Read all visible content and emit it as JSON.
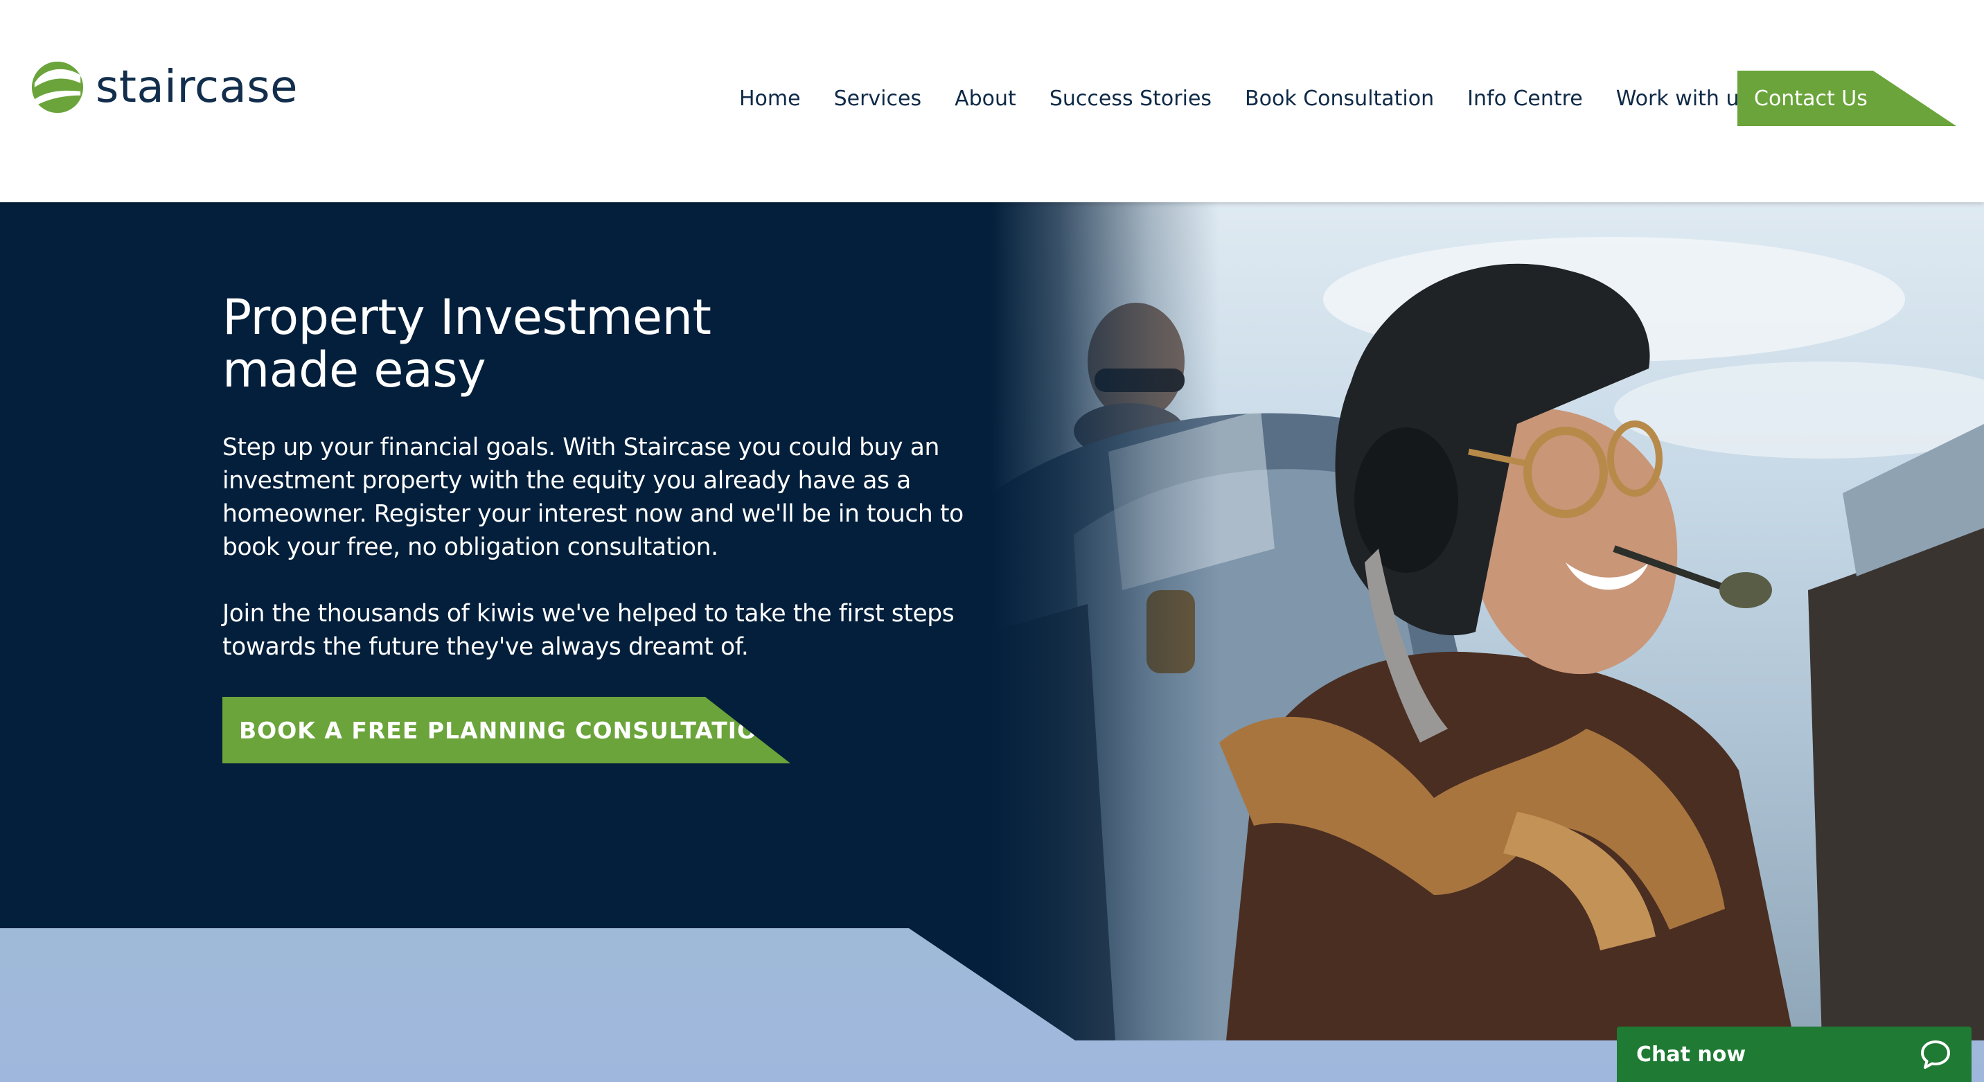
{
  "brand": {
    "name": "staircase",
    "logo_icon": "staircase-s-logo-icon",
    "colors": {
      "navy": "#031f3b",
      "green": "#6aa43a",
      "light_blue": "#a0b7dd",
      "chat_green": "#1f7a34"
    }
  },
  "nav": {
    "items": [
      {
        "label": "Home"
      },
      {
        "label": "Services"
      },
      {
        "label": "About"
      },
      {
        "label": "Success Stories"
      },
      {
        "label": "Book Consultation"
      },
      {
        "label": "Info Centre"
      },
      {
        "label": "Work with us"
      }
    ],
    "contact_label": "Contact Us"
  },
  "hero": {
    "title_line1": "Property Investment",
    "title_line2": "made easy",
    "paragraph1": "Step up your financial goals. With Staircase you could buy an investment property with the equity you already have as a homeowner. Register your interest now and we'll be in touch to book your free, no obligation consultation.",
    "paragraph2": "Join the thousands of kiwis we've helped to take the first steps towards the future they've always dreamt of.",
    "cta_label": "BOOK A FREE PLANNING CONSULTATION"
  },
  "chat": {
    "label": "Chat now",
    "icon": "chat-bubble-icon"
  }
}
